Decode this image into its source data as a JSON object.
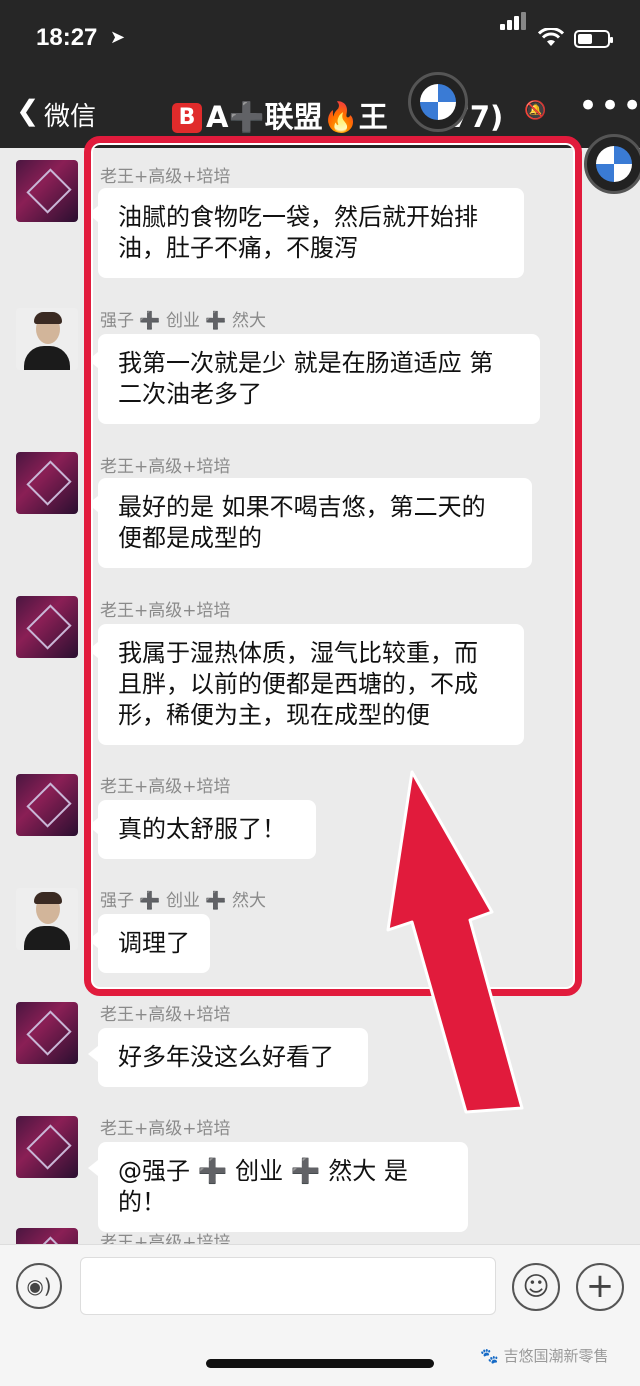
{
  "status": {
    "time": "18:27"
  },
  "nav": {
    "back_label": "微信",
    "title_b": "B",
    "title_text": "A",
    "title_plus": "➕",
    "title_mid": "联盟",
    "title_fire": "🔥",
    "title_end": "王",
    "title_count": "77)"
  },
  "messages": [
    {
      "sender": "老王+高级+培培",
      "avatar": "lw",
      "lines": [
        "油腻的食物吃一袋，然后就开始排",
        "油，肚子不痛，不腹泻"
      ]
    },
    {
      "sender": "强子 ➕ 创业 ➕ 然大",
      "avatar": "qz",
      "lines": [
        "我第一次就是少 就是在肠道适应 第",
        "二次油老多了"
      ]
    },
    {
      "sender": "老王+高级+培培",
      "avatar": "lw",
      "lines": [
        "最好的是 如果不喝吉悠，第二天的",
        "便都是成型的"
      ]
    },
    {
      "sender": "老王+高级+培培",
      "avatar": "lw",
      "lines": [
        "我属于湿热体质，湿气比较重，而",
        "且胖，以前的便都是西塘的，不成",
        "形，稀便为主，现在成型的便"
      ]
    },
    {
      "sender": "老王+高级+培培",
      "avatar": "lw",
      "lines": [
        "真的太舒服了！"
      ]
    },
    {
      "sender": "强子 ➕ 创业 ➕ 然大",
      "avatar": "qz",
      "lines": [
        "调理了"
      ]
    },
    {
      "sender": "老王+高级+培培",
      "avatar": "lw",
      "lines": [
        "好多年没这么好看了"
      ]
    },
    {
      "sender": "老王+高级+培培",
      "avatar": "lw",
      "lines": [
        "@强子 ➕ 创业 ➕ 然大 是的！"
      ]
    },
    {
      "sender": "老王+高级+培培",
      "avatar": "lw",
      "lines": []
    }
  ],
  "watermark": "吉悠国潮新零售",
  "colors": {
    "highlight": "#e11b3c",
    "nav_bg": "#262626",
    "chat_bg": "#ebebeb"
  }
}
